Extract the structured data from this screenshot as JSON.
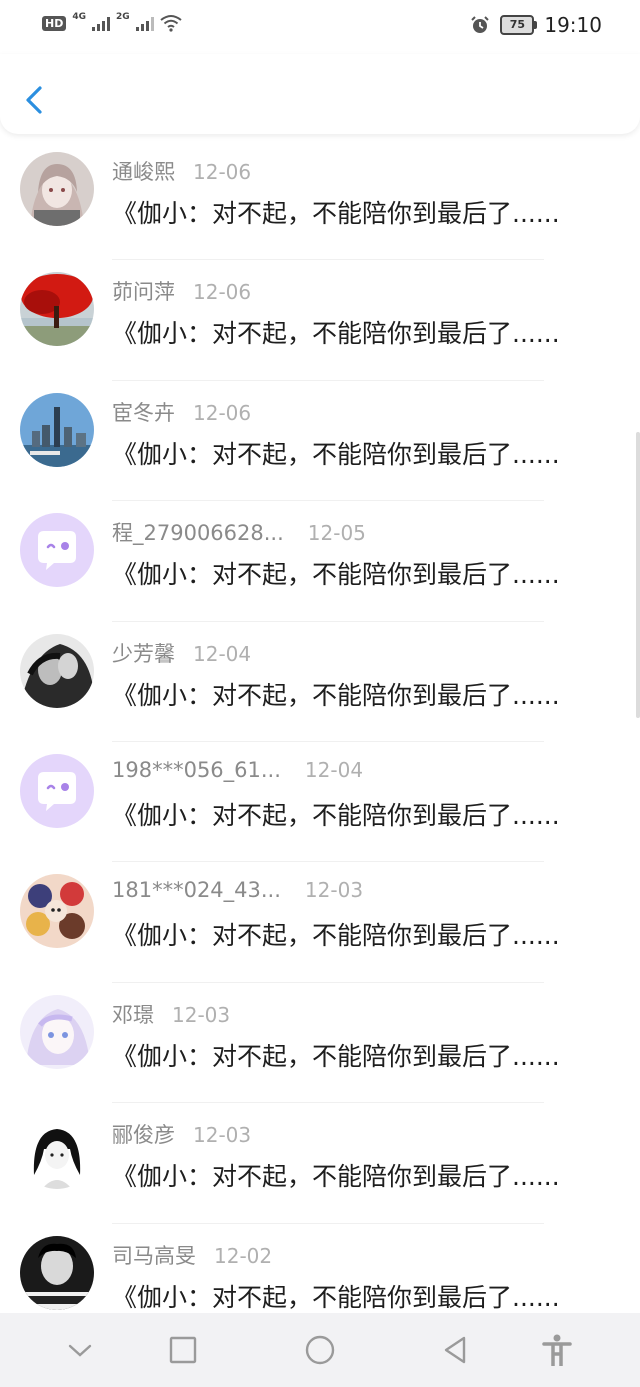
{
  "status": {
    "hd": "HD",
    "net1": "4G",
    "net2": "2G",
    "battery": "75",
    "time": "19:10"
  },
  "messages": [
    {
      "name": "通峻熙",
      "date": "12-06",
      "text": "《伽小：对不起，不能陪你到最后了......",
      "avatar": "anime-girl"
    },
    {
      "name": "茆问萍",
      "date": "12-06",
      "text": "《伽小：对不起，不能陪你到最后了......",
      "avatar": "red-tree"
    },
    {
      "name": "宦冬卉",
      "date": "12-06",
      "text": "《伽小：对不起，不能陪你到最后了......",
      "avatar": "city-skyline"
    },
    {
      "name": "程_279006628...",
      "date": "12-05",
      "text": "《伽小：对不起，不能陪你到最后了......",
      "avatar": "default-chat"
    },
    {
      "name": "少芳馨",
      "date": "12-04",
      "text": "《伽小：对不起，不能陪你到最后了......",
      "avatar": "bw-photo"
    },
    {
      "name": "198***056_61...",
      "date": "12-04",
      "text": "《伽小：对不起，不能陪你到最后了......",
      "avatar": "default-chat"
    },
    {
      "name": "181***024_43...",
      "date": "12-03",
      "text": "《伽小：对不起，不能陪你到最后了......",
      "avatar": "anime-group"
    },
    {
      "name": "邓璟",
      "date": "12-03",
      "text": "《伽小：对不起，不能陪你到最后了......",
      "avatar": "pastel-anime"
    },
    {
      "name": "郦俊彦",
      "date": "12-03",
      "text": "《伽小：对不起，不能陪你到最后了......",
      "avatar": "sketch-girl"
    },
    {
      "name": "司马高旻",
      "date": "12-02",
      "text": "《伽小：对不起，不能陪你到最后了......",
      "avatar": "bw-portrait"
    }
  ],
  "colors": {
    "accent": "#2b8fe0",
    "default_avatar_bg": "#e4d6fb",
    "default_avatar_fg": "#a883e8"
  },
  "icons": {
    "back": "chevron-left-icon",
    "nav": [
      "collapse-icon",
      "square-icon",
      "circle-icon",
      "triangle-back-icon",
      "accessibility-icon"
    ]
  }
}
